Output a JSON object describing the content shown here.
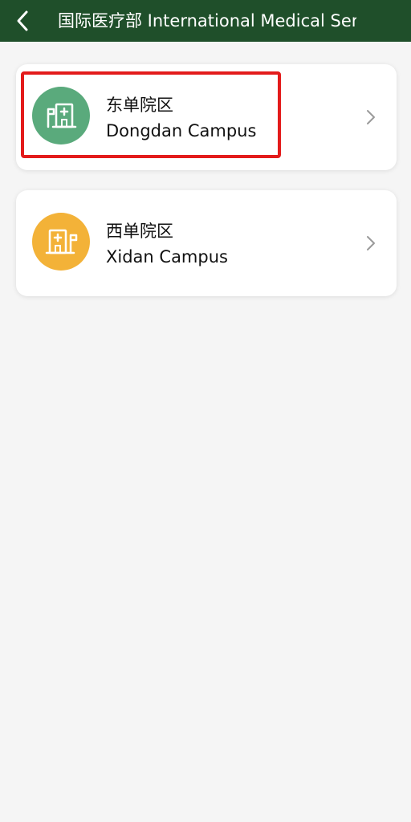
{
  "header": {
    "title": "国际医疗部 International Medical Serv",
    "back_icon": "chevron-left-icon",
    "background_color": "#1f4f2a"
  },
  "campuses": [
    {
      "title_cn": "东单院区",
      "title_en": "Dongdan Campus",
      "icon": "hospital-building-icon",
      "icon_color": "#5aaa7c"
    },
    {
      "title_cn": "西单院区",
      "title_en": "Xidan Campus",
      "icon": "hospital-building-icon",
      "icon_color": "#f3b238"
    }
  ],
  "highlight_color": "#e31b1b"
}
